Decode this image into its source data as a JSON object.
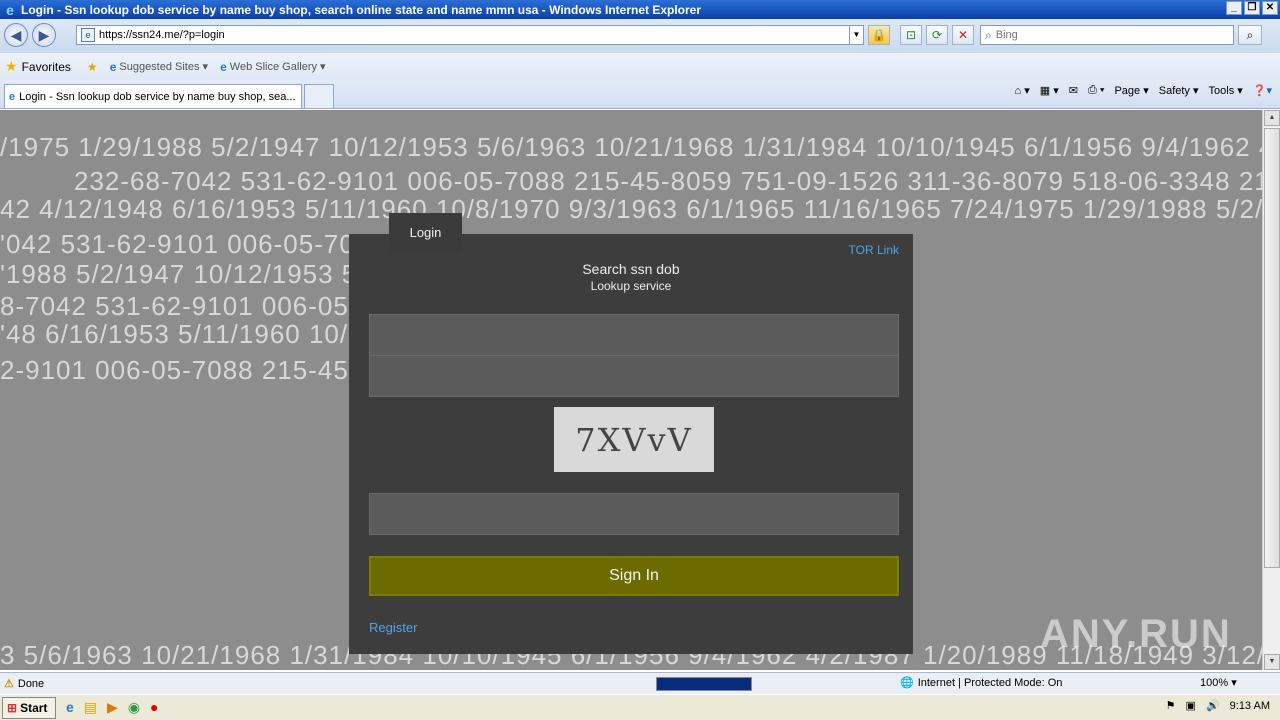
{
  "window": {
    "title": "Login - Ssn lookup dob service by name buy shop, search online state and name mmn usa - Windows Internet Explorer",
    "min": "_",
    "max": "❐",
    "close": "✕"
  },
  "address": {
    "url": "https://ssn24.me/?p=login",
    "search_placeholder": "Bing"
  },
  "favorites": {
    "label": "Favorites",
    "suggested_sites": "Suggested Sites",
    "web_slice_gallery": "Web Slice Gallery"
  },
  "tabs": [
    {
      "label": "Login - Ssn lookup dob service by name buy shop, sea..."
    }
  ],
  "command_bar": {
    "page": "Page",
    "safety": "Safety",
    "tools": "Tools"
  },
  "background_lines": [
    "/1975  1/29/1988  5/2/1947  10/12/1953  5/6/1963  10/21/1968  1/31/1984  10/10/1945  6/1/1956  9/4/1962  4/2",
    "232-68-7042  531-62-9101  006-05-7088  215-45-8059  751-09-1526  311-36-8079  518-06-3348  215",
    "42  4/12/1948  6/16/1953  5/11/1960  10/8/1970  9/3/1963  6/1/1965  11/16/1965  7/24/1975  1/29/1988  5/2/19",
    "'042  531-62-9101  006-05-7088",
    "'1988  5/2/1947  10/12/1953  5/6",
    "8-7042  531-62-9101  006-05-",
    "'48  6/16/1953  5/11/1960  10/8",
    "2-9101  006-05-7088  215-45-",
    "3  5/6/1963  10/21/1968  1/31/1984  10/10/1945  6/1/1956  9/4/1962  4/2/1987  1/20/1989  11/18/1949  3/12/19"
  ],
  "login": {
    "tab_label": "Login",
    "tor_link": "TOR Link",
    "title": "Search ssn dob",
    "subtitle": "Lookup service",
    "username_value": "",
    "password_value": "",
    "captcha_text": "7XVvV",
    "captcha_value": "",
    "sign_in_label": "Sign In",
    "register_label": "Register"
  },
  "watermark": "ANY.RUN",
  "status": {
    "text": "Done",
    "progress": 1.0,
    "zone": "Internet | Protected Mode: On",
    "zoom": "100%"
  },
  "taskbar": {
    "start": "Start",
    "time": "9:13 AM"
  },
  "colors": {
    "panel": "#3d3d3d",
    "signin": "#6b6b00",
    "link": "#4fa3e8"
  }
}
